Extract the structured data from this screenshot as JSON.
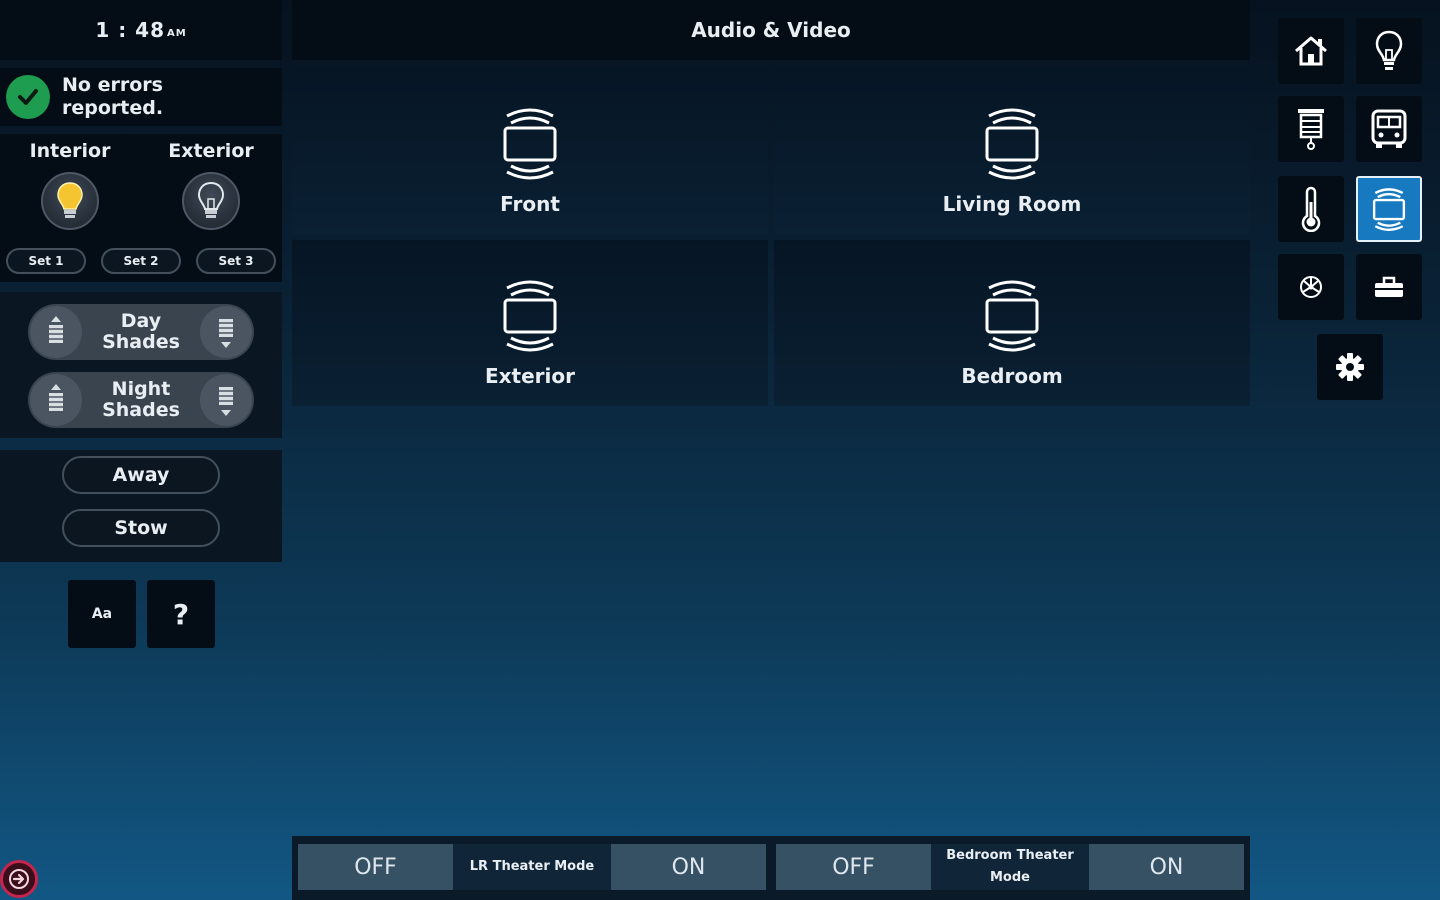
{
  "left": {
    "time": "1 : 48",
    "ampm": "AM",
    "status": {
      "line1": "No errors",
      "line2": "reported."
    },
    "lights": [
      {
        "label": "Interior",
        "state": "on"
      },
      {
        "label": "Exterior",
        "state": "off"
      }
    ],
    "sets": [
      "Set 1",
      "Set 2",
      "Set 3"
    ],
    "shades": [
      {
        "line1": "Day",
        "line2": "Shades"
      },
      {
        "line1": "Night",
        "line2": "Shades"
      }
    ],
    "scenes": [
      "Away",
      "Stow"
    ],
    "font_button": "Aa",
    "help_button": "?"
  },
  "center": {
    "title": "Audio & Video",
    "rooms": [
      "Front",
      "Living Room",
      "Exterior",
      "Bedroom"
    ],
    "footer": [
      {
        "off": "OFF",
        "label": "LR Theater Mode",
        "on": "ON"
      },
      {
        "off": "OFF",
        "label": "Bedroom Theater Mode",
        "on": "ON"
      }
    ]
  },
  "right_nav": {
    "items": [
      {
        "icon": "home-icon",
        "active": false
      },
      {
        "icon": "lightbulb-icon",
        "active": false
      },
      {
        "icon": "shade-icon",
        "active": false
      },
      {
        "icon": "bus-icon",
        "active": false
      },
      {
        "icon": "thermometer-icon",
        "active": false
      },
      {
        "icon": "tv-icon",
        "active": true
      },
      {
        "icon": "fan-icon",
        "active": false
      },
      {
        "icon": "toolbox-icon",
        "active": false
      },
      {
        "icon": "gear-icon",
        "active": false
      }
    ]
  },
  "colors": {
    "accent": "#1779bf",
    "success": "#1e9c4f",
    "bulb_on": "#f4c531",
    "panel": "#040d16"
  }
}
